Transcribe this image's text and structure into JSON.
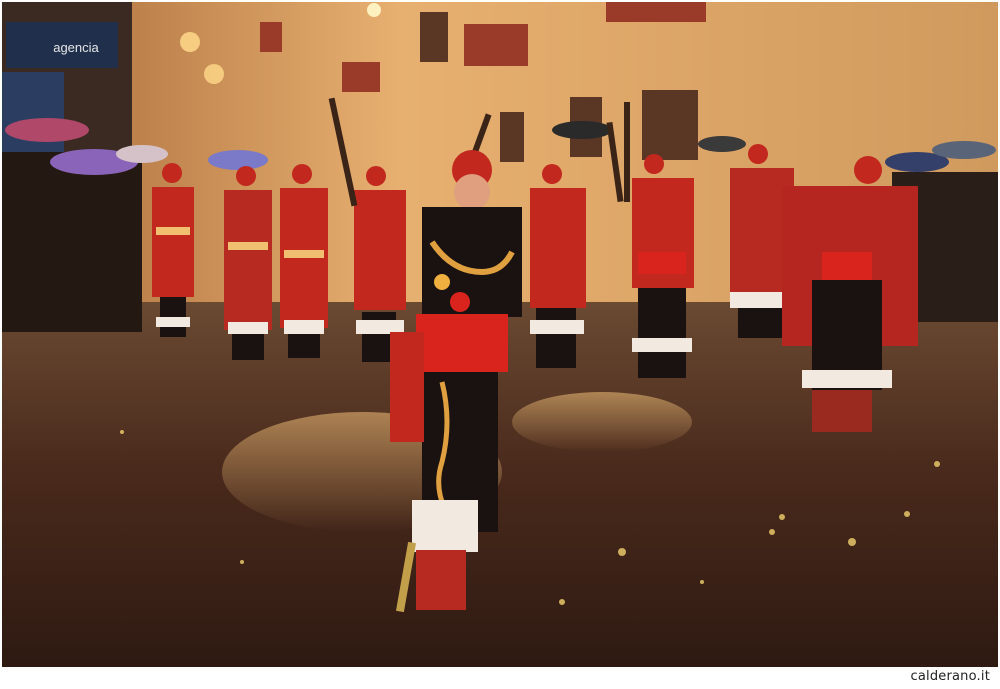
{
  "photo": {
    "signs": {
      "shop_sign": "agencia"
    },
    "colors": {
      "street": "#4a2a1c",
      "wall": "#e7b070",
      "costume_red": "#c2281e",
      "costume_black": "#1a1210",
      "confetti": "#e8c86a"
    }
  },
  "footer": {
    "credit": "calderano.it"
  }
}
